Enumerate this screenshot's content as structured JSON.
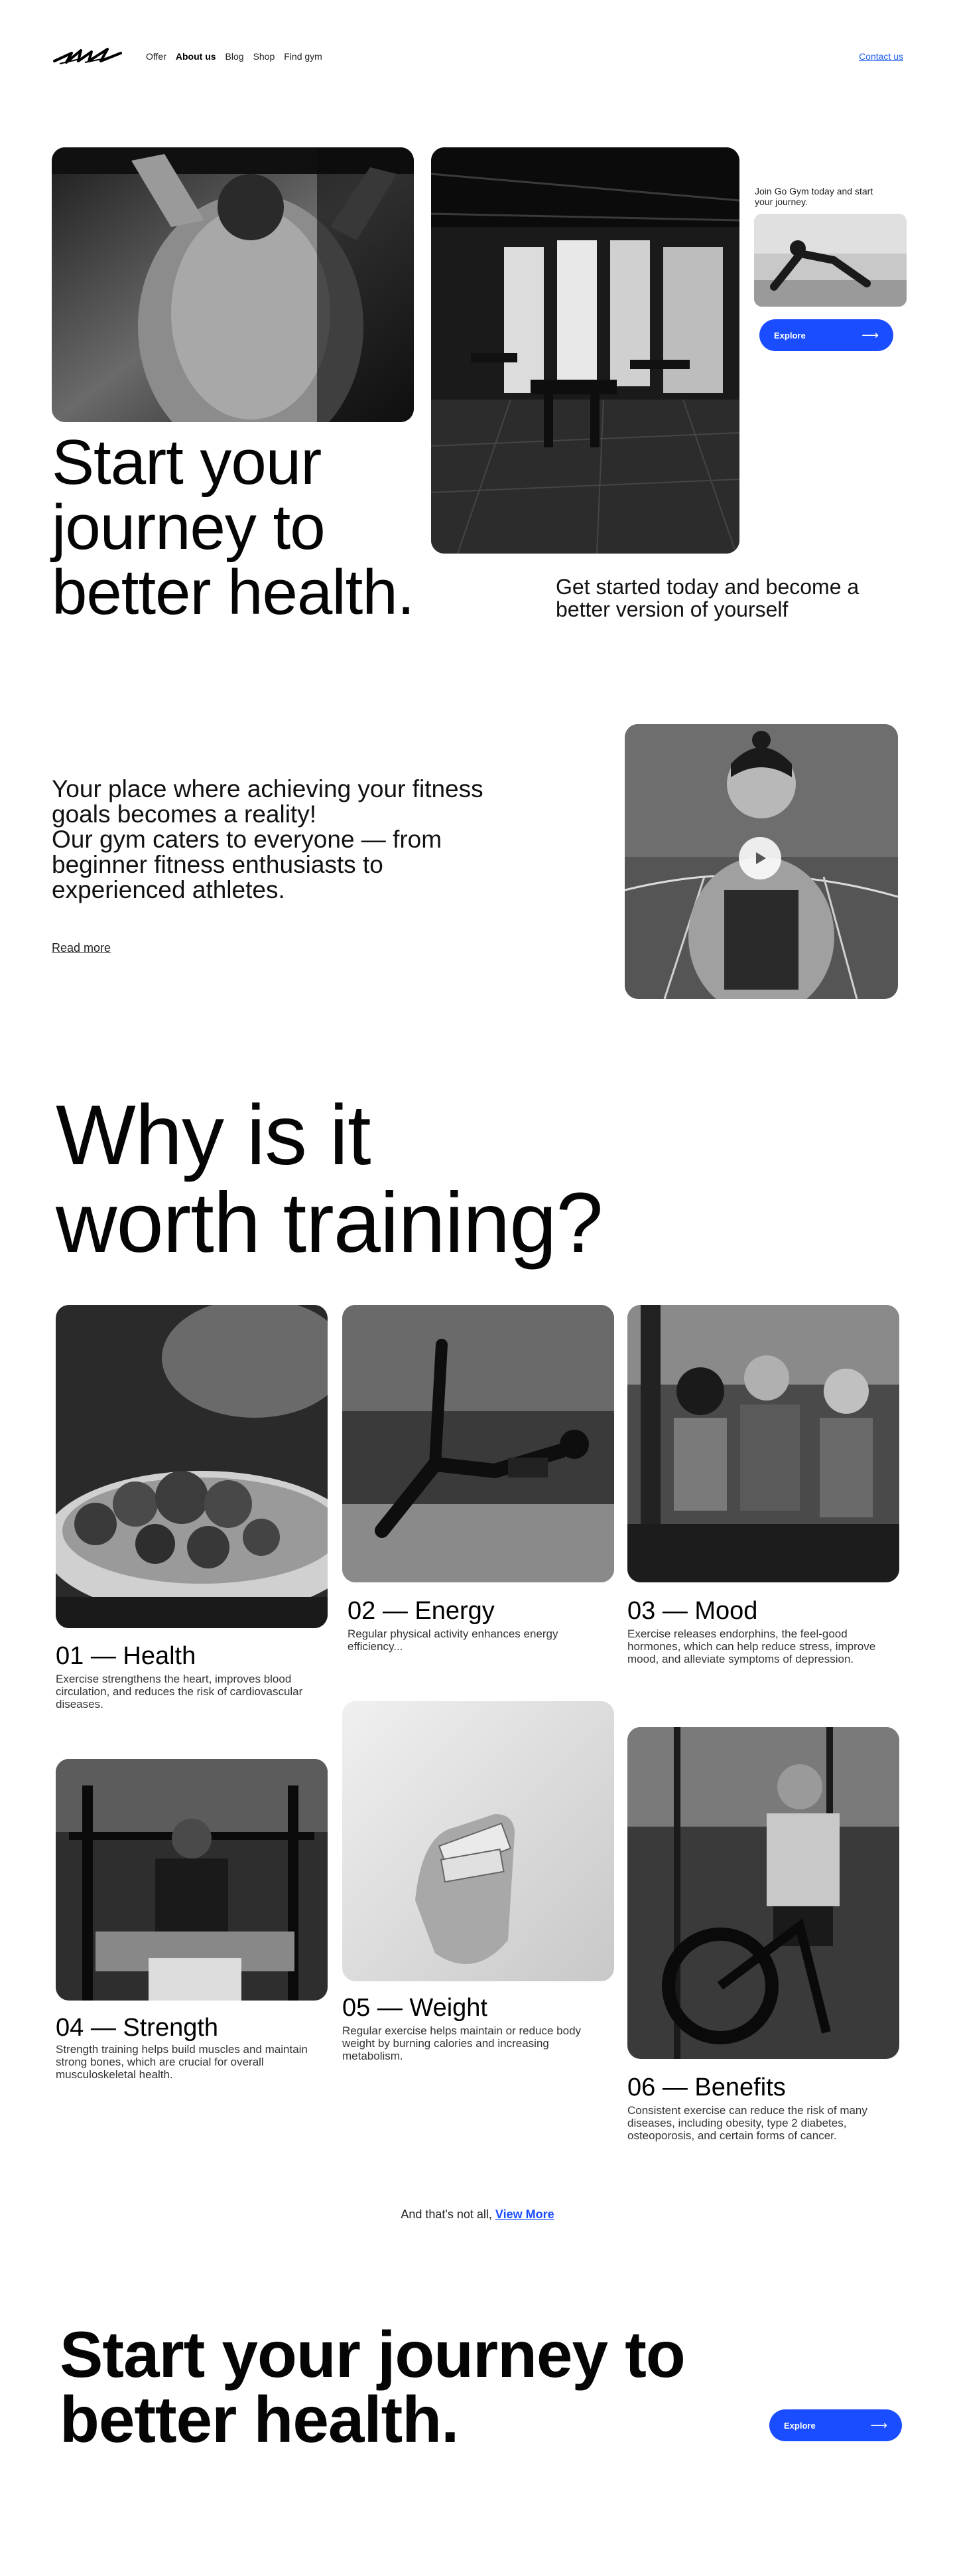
{
  "nav": {
    "items": [
      {
        "label": "Offer"
      },
      {
        "label": "About us"
      },
      {
        "label": "Blog"
      },
      {
        "label": "Shop"
      },
      {
        "label": "Find gym"
      }
    ],
    "contact_label": "Contact us"
  },
  "hero": {
    "title_line1": "Start your",
    "title_line2": "journey to",
    "title_line3": "better health.",
    "join_text": "Join Go Gym today and start your journey.",
    "explore_label": "Explore",
    "subtitle": "Get started today and become a better version of yourself"
  },
  "about": {
    "text_line1": "Your place where achieving your fitness goals becomes a reality!",
    "text_line2": "Our gym caters to everyone — from beginner fitness enthusiasts to experienced athletes.",
    "read_more_label": "Read more"
  },
  "why": {
    "title_line1": "Why is it",
    "title_line2": "worth training?",
    "cards": [
      {
        "title": "01 — Health",
        "desc": "Exercise strengthens the heart, improves blood circulation, and reduces the risk of cardiovascular diseases."
      },
      {
        "title": "02 — Energy",
        "desc": "Regular physical activity enhances energy efficiency..."
      },
      {
        "title": "03 — Mood",
        "desc": "Exercise releases endorphins, the feel-good hormones, which can help reduce stress, improve mood, and alleviate symptoms of depression."
      },
      {
        "title": "04 — Strength",
        "desc": "Strength training helps build muscles and maintain strong bones, which are crucial for overall musculoskeletal health."
      },
      {
        "title": "05 — Weight",
        "desc": "Regular exercise helps maintain or reduce body weight by burning calories and increasing metabolism."
      },
      {
        "title": "06 — Benefits",
        "desc": "Consistent exercise can reduce the risk of many diseases, including obesity, type 2 diabetes, osteoporosis, and certain forms of cancer."
      }
    ]
  },
  "more": {
    "prefix": "And that's not all,",
    "link_label": "View More"
  },
  "final": {
    "title_line1": "Start your journey to",
    "title_line2": "better health.",
    "explore_label": "Explore"
  },
  "colors": {
    "accent": "#1a4dff",
    "link": "#1a5cf0"
  },
  "icons": {
    "arrow": "long-arrow-right-icon",
    "play": "play-icon",
    "logo": "brand-logo"
  }
}
